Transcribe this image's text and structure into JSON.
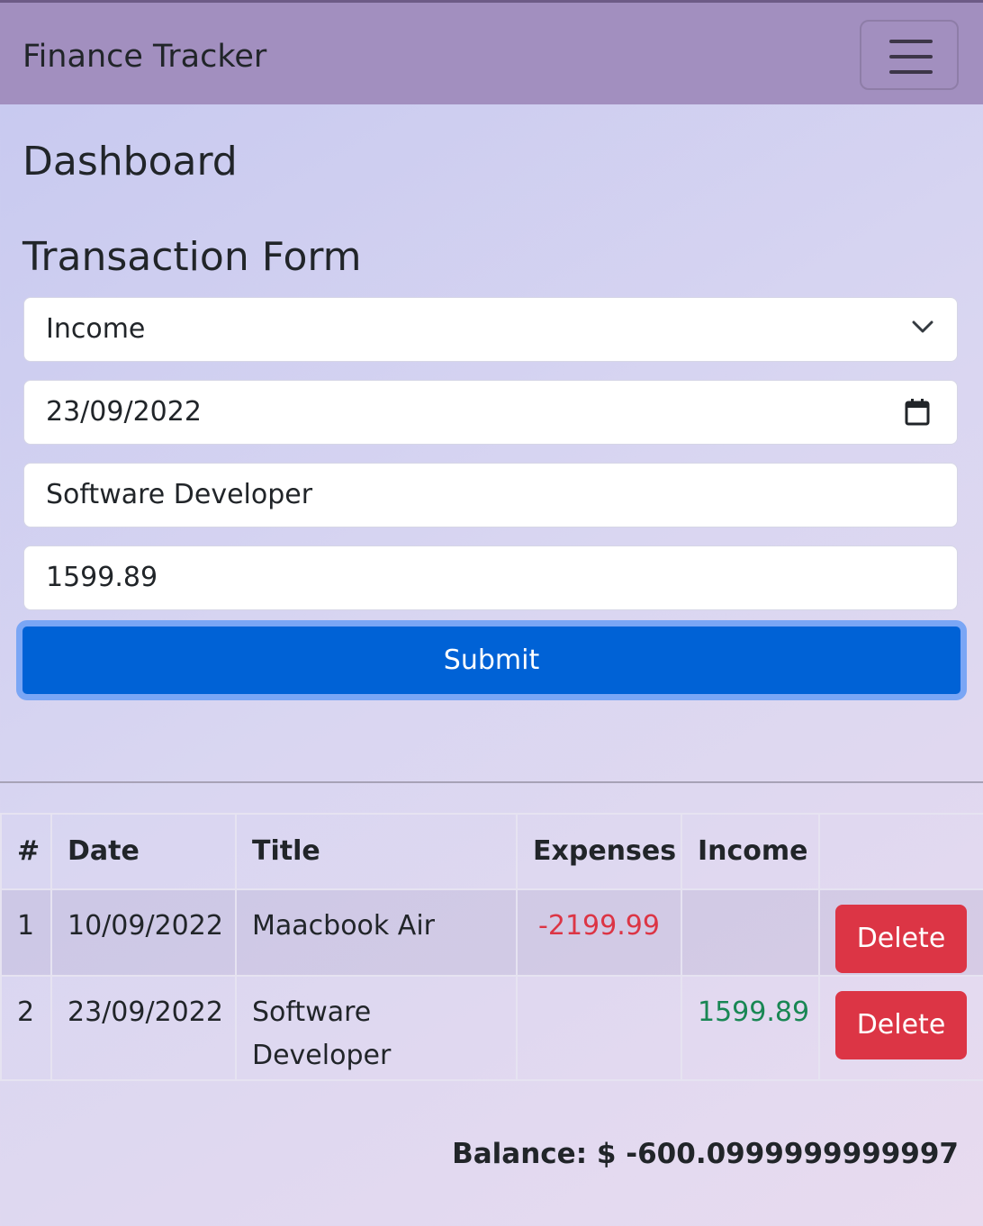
{
  "navbar": {
    "brand": "Finance Tracker"
  },
  "page": {
    "title": "Dashboard",
    "form_title": "Transaction Form"
  },
  "form": {
    "type_value": "Income",
    "date_value": "23/09/2022",
    "title_value": "Software Developer",
    "amount_value": "1599.89",
    "submit_label": "Submit"
  },
  "table": {
    "headers": [
      "#",
      "Date",
      "Title",
      "Expenses",
      "Income"
    ],
    "rows": [
      {
        "num": "1",
        "date": "10/09/2022",
        "title": "Maacbook Air",
        "expense": "-2199.99",
        "income": "",
        "action": "Delete"
      },
      {
        "num": "2",
        "date": "23/09/2022",
        "title": "Software Developer",
        "expense": "",
        "income": "1599.89",
        "action": "Delete"
      }
    ]
  },
  "balance": "Balance: $ -600.0999999999997",
  "colors": {
    "navbar": "#a28fbf",
    "primary": "#0062d6",
    "danger": "#dc3545",
    "success": "#198754"
  }
}
